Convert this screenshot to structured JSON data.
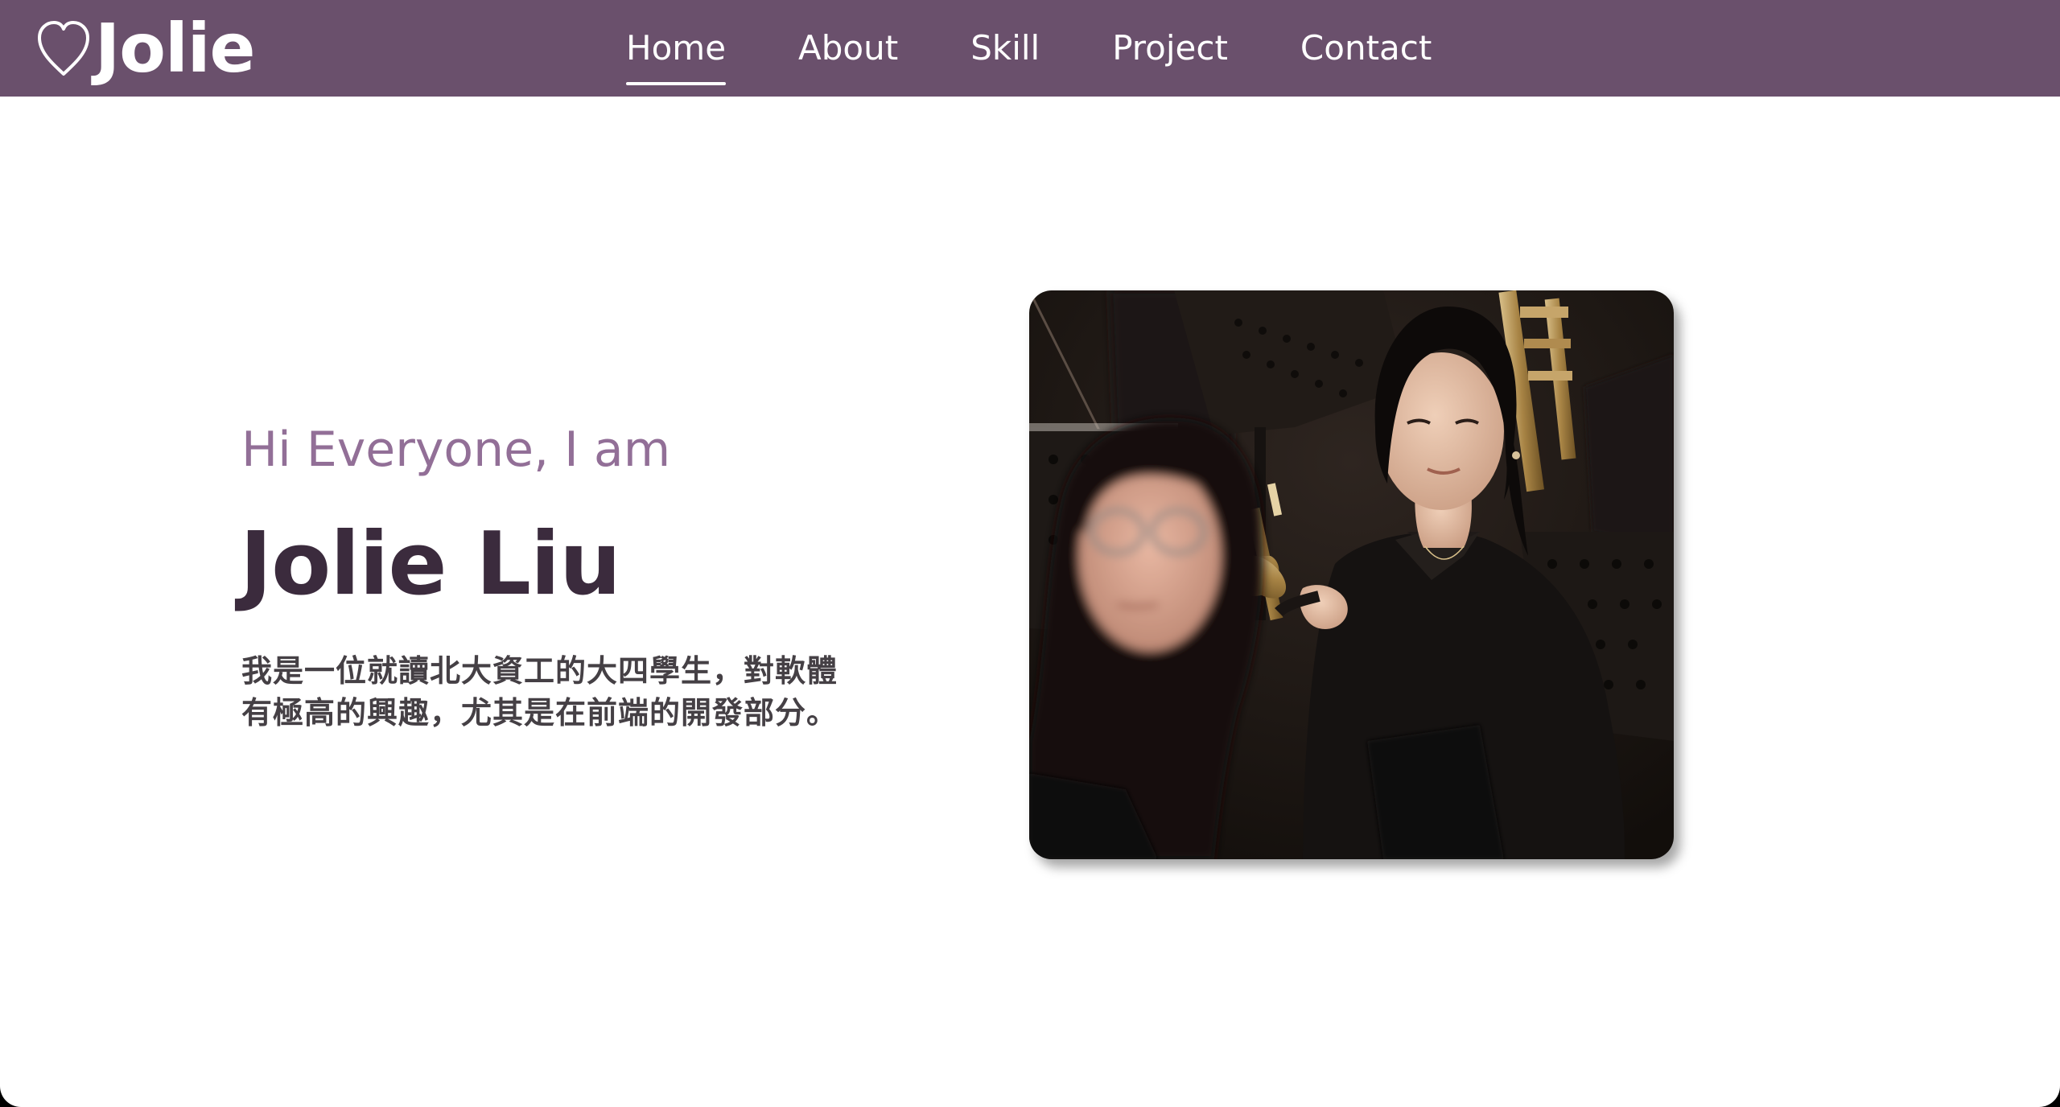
{
  "brand": {
    "name": "Jolie",
    "icon": "heart-outline-icon"
  },
  "nav": {
    "items": [
      {
        "label": "Home",
        "active": true
      },
      {
        "label": "About",
        "active": false
      },
      {
        "label": "Skill",
        "active": false
      },
      {
        "label": "Project",
        "active": false
      },
      {
        "label": "Contact",
        "active": false
      }
    ]
  },
  "hero": {
    "greeting": "Hi Everyone, I am",
    "name": "Jolie Liu",
    "intro_line1": "我是一位就讀北大資工的大四學生，對軟體",
    "intro_line2": "有極高的興趣，尤其是在前端的開發部分。"
  },
  "colors": {
    "navbar": "#6a506c",
    "greeting": "#926f97",
    "name": "#3b2b3d",
    "text": "#454045"
  }
}
